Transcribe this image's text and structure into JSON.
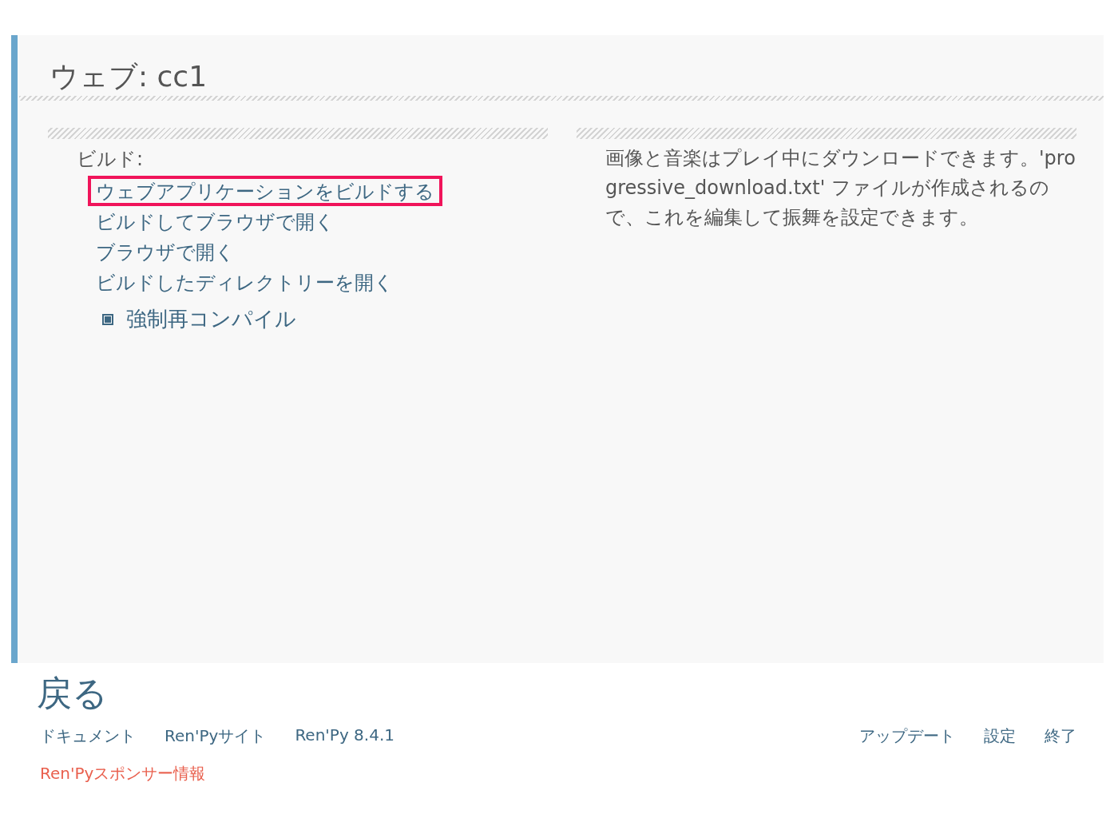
{
  "title": "ウェブ: cc1",
  "build": {
    "label": "ビルド:",
    "actions": [
      {
        "label": "ウェブアプリケーションをビルドする",
        "highlighted": true
      },
      {
        "label": "ビルドしてブラウザで開く",
        "highlighted": false
      },
      {
        "label": "ブラウザで開く",
        "highlighted": false
      },
      {
        "label": "ビルドしたディレクトリーを開く",
        "highlighted": false
      }
    ],
    "option": {
      "label": "強制再コンパイル",
      "checked": true
    }
  },
  "description": "画像と音楽はプレイ中にダウンロードできます。'progressive_download.txt' ファイルが作成されるので、これを編集して振舞を設定できます。",
  "back": "戻る",
  "footer": {
    "left": [
      "ドキュメント",
      "Ren'Pyサイト",
      "Ren'Py 8.4.1"
    ],
    "right": [
      "アップデート",
      "設定",
      "終了"
    ],
    "sponsor": "Ren'Pyスポンサー情報"
  }
}
